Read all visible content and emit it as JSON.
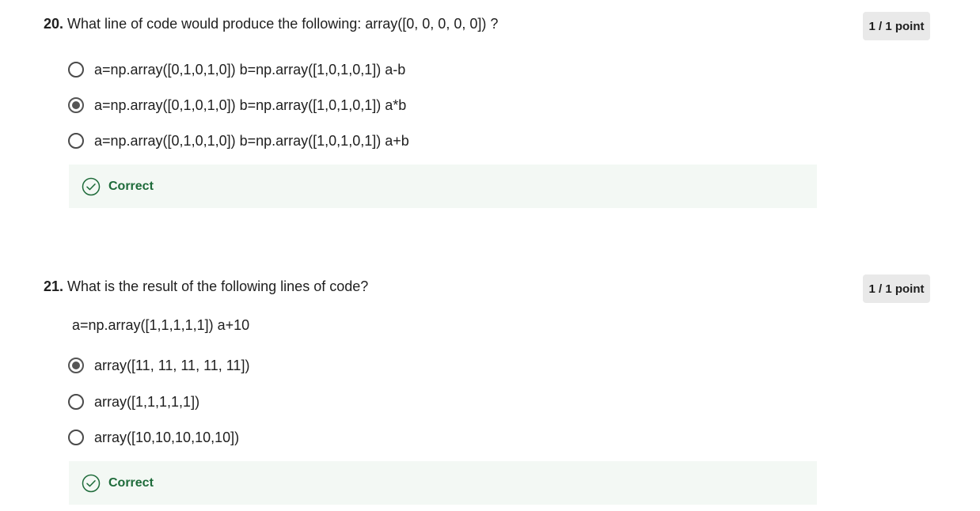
{
  "questions": [
    {
      "number": "20.",
      "text": "What line of code would produce the following: array([0, 0, 0, 0, 0]) ?",
      "points": "1 / 1 point",
      "options": [
        {
          "label": "a=np.array([0,1,0,1,0]) b=np.array([1,0,1,0,1]) a-b",
          "selected": false
        },
        {
          "label": "a=np.array([0,1,0,1,0]) b=np.array([1,0,1,0,1]) a*b",
          "selected": true
        },
        {
          "label": "a=np.array([0,1,0,1,0]) b=np.array([1,0,1,0,1]) a+b",
          "selected": false
        }
      ],
      "feedback": {
        "text": "Correct",
        "icon": "check-circle-icon",
        "color": "#1e6b3a"
      }
    },
    {
      "number": "21.",
      "text": "What is the result of the following lines of code?",
      "code": "a=np.array([1,1,1,1,1]) a+10",
      "points": "1 / 1 point",
      "options": [
        {
          "label": "array([11, 11, 11, 11, 11])",
          "selected": true
        },
        {
          "label": "array([1,1,1,1,1])",
          "selected": false
        },
        {
          "label": "array([10,10,10,10,10])",
          "selected": false
        }
      ],
      "feedback": {
        "text": "Correct",
        "icon": "check-circle-icon",
        "color": "#1e6b3a"
      }
    }
  ],
  "colors": {
    "feedback_bg": "#f3f8f4",
    "badge_bg": "#e9e9e9",
    "success": "#1e6b3a"
  }
}
